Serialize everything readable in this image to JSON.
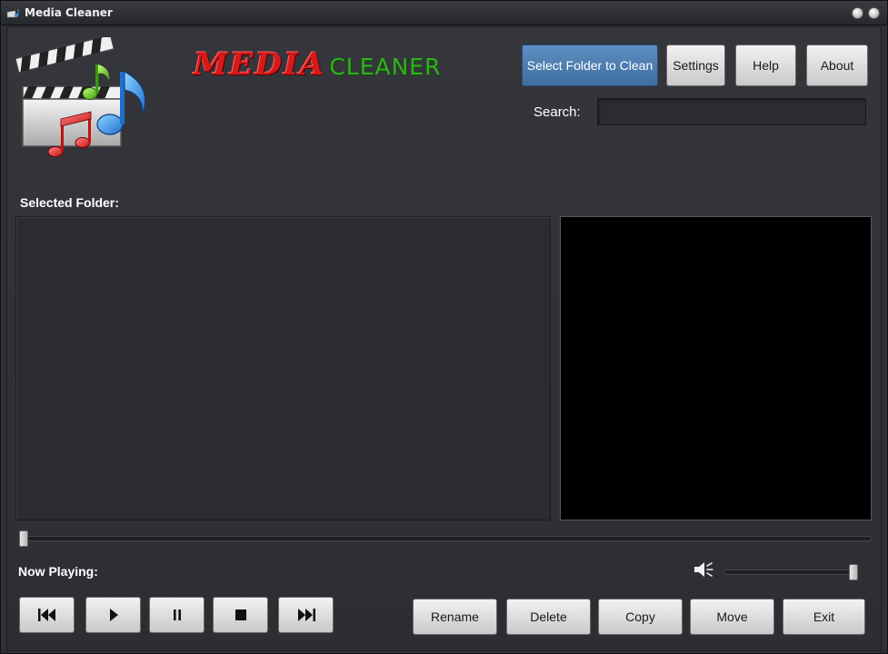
{
  "window": {
    "title": "Media Cleaner"
  },
  "brand": {
    "part1": "MEDIA",
    "part2": "CLEANER"
  },
  "toolbar": {
    "select_folder": "Select Folder to Clean",
    "settings": "Settings",
    "help": "Help",
    "about": "About"
  },
  "search": {
    "label": "Search:",
    "value": ""
  },
  "folder": {
    "label": "Selected Folder:"
  },
  "player": {
    "now_playing_label": "Now Playing:",
    "seek_fraction": 0.0,
    "volume_fraction": 1.0
  },
  "actions": {
    "rename": "Rename",
    "delete": "Delete",
    "copy": "Copy",
    "move": "Move",
    "exit": "Exit"
  },
  "icons": {
    "app": "clapperboard-music-icon",
    "previous": "skip-back-icon",
    "play": "play-icon",
    "pause": "pause-icon",
    "stop": "stop-icon",
    "next": "skip-forward-icon",
    "volume": "speaker-icon"
  },
  "colors": {
    "brand_red": "#d61a1a",
    "brand_green": "#33b01f",
    "accent_blue": "#4f7fb1",
    "video_bg": "#000000"
  }
}
